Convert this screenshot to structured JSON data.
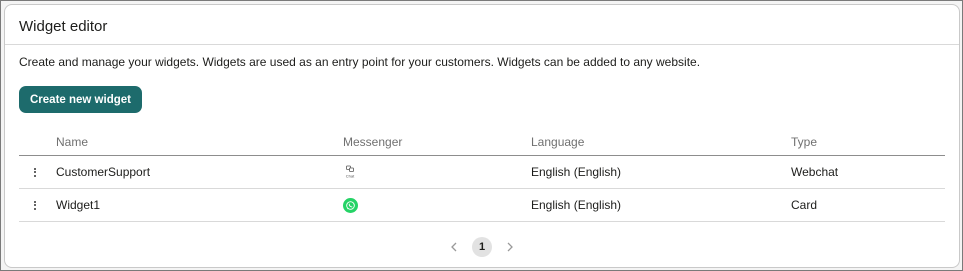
{
  "page": {
    "title": "Widget editor",
    "description": "Create and manage your widgets. Widgets are used as an entry point for your customers. Widgets can be added to any website.",
    "create_button": "Create new widget"
  },
  "table": {
    "columns": {
      "name": "Name",
      "messenger": "Messenger",
      "language": "Language",
      "type": "Type"
    },
    "rows": [
      {
        "name": "CustomerSupport",
        "messenger_icon": "chat-icon",
        "messenger_icon_label": "Chat",
        "language": "English (English)",
        "type": "Webchat"
      },
      {
        "name": "Widget1",
        "messenger_icon": "whatsapp-icon",
        "language": "English (English)",
        "type": "Card"
      }
    ]
  },
  "pagination": {
    "current_page": "1",
    "prev_icon": "chevron-left-icon",
    "next_icon": "chevron-right-icon"
  },
  "colors": {
    "primary": "#1d6b6c",
    "whatsapp": "#25d366"
  }
}
